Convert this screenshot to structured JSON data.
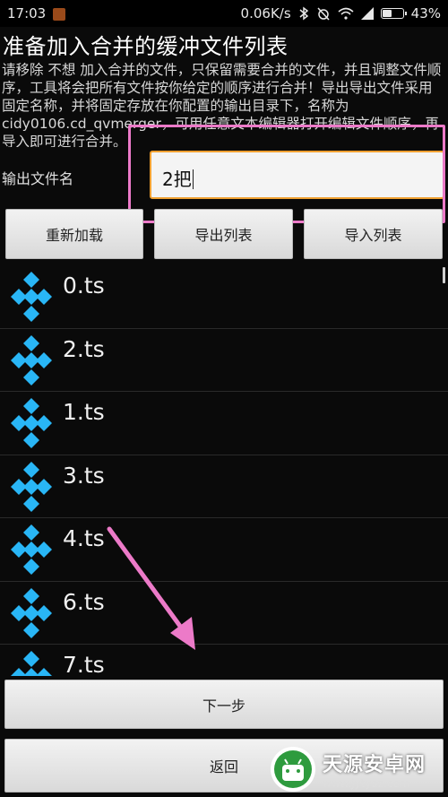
{
  "status_bar": {
    "time": "17:03",
    "network_speed": "0.06K/s",
    "battery_percent": "43%",
    "icons": [
      "notification-icon",
      "bluetooth-icon",
      "alarm-off-icon",
      "wifi-icon",
      "signal-icon",
      "battery-icon"
    ]
  },
  "page": {
    "title": "准备加入合并的缓冲文件列表",
    "description": "请移除 不想 加入合并的文件，只保留需要合并的文件，并且调整文件顺序，工具将会把所有文件按你给定的顺序进行合并！导出导出文件采用固定名称，并将固定存放在你配置的输出目录下，名称为cidy0106.cd_qvmerger，可用任意文本编辑器打开编辑文件顺序，再导入即可进行合并。"
  },
  "output": {
    "label": "输出文件名",
    "value": "2把"
  },
  "toolbar": {
    "reload_label": "重新加载",
    "export_label": "导出列表",
    "import_label": "导入列表"
  },
  "files": [
    {
      "name": "0.ts"
    },
    {
      "name": "2.ts"
    },
    {
      "name": "1.ts"
    },
    {
      "name": "3.ts"
    },
    {
      "name": "4.ts"
    },
    {
      "name": "6.ts"
    },
    {
      "name": "7.ts"
    }
  ],
  "actions": {
    "next_label": "下一步",
    "back_label": "返回"
  },
  "watermark": {
    "title": "天源安卓网",
    "url": "www.jytyaz.com"
  },
  "colors": {
    "accent": "#f0a030",
    "highlight": "#ec7ac8",
    "icon": "#29b6f6"
  }
}
